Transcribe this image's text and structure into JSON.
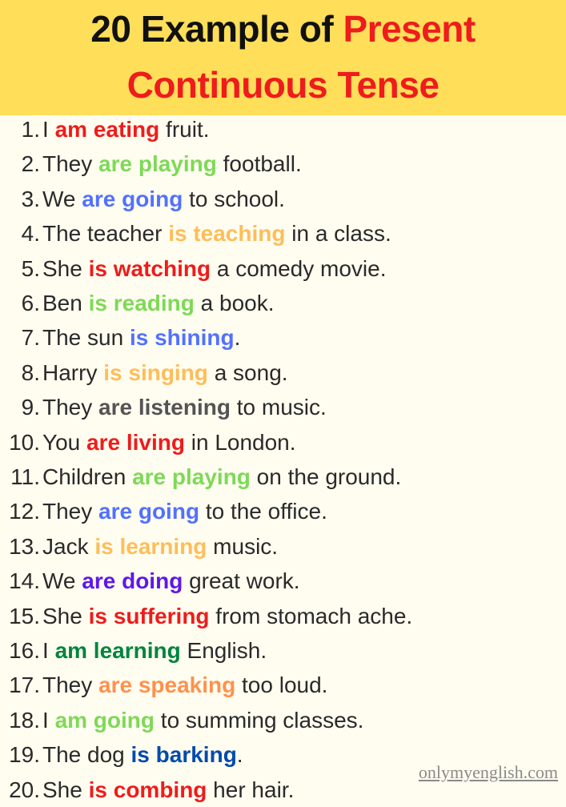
{
  "header": {
    "title_part1": "20 Example of ",
    "title_part2": "Present",
    "title_line2": "Continuous Tense",
    "background": "#ffde59",
    "accent": "#ee1c1c"
  },
  "examples": [
    {
      "num": "1.",
      "before": "I ",
      "verb": "am eating",
      "after": " fruit.",
      "color": "#ee1c1c"
    },
    {
      "num": "2.",
      "before": "They ",
      "verb": "are playing",
      "after": " football.",
      "color": "#7ed957"
    },
    {
      "num": "3.",
      "before": "We ",
      "verb": "are going",
      "after": " to school.",
      "color": "#5271ff"
    },
    {
      "num": "4.",
      "before": "The teacher ",
      "verb": "is teaching",
      "after": " in a class.",
      "color": "#ffbd59"
    },
    {
      "num": "5.",
      "before": "She ",
      "verb": "is watching",
      "after": " a comedy movie.",
      "color": "#ee1c1c"
    },
    {
      "num": "6.",
      "before": "Ben ",
      "verb": "is reading",
      "after": " a book.",
      "color": "#7ed957"
    },
    {
      "num": "7.",
      "before": "The sun ",
      "verb": "is shining",
      "after": ".",
      "color": "#5271ff"
    },
    {
      "num": "8.",
      "before": "Harry ",
      "verb": "is singing",
      "after": " a song.",
      "color": "#ffbd59"
    },
    {
      "num": "9.",
      "before": "They ",
      "verb": "are listening",
      "after": " to music.",
      "color": "#545454"
    },
    {
      "num": "10.",
      "before": "You ",
      "verb": "are living",
      "after": " in London.",
      "color": "#ee1c1c"
    },
    {
      "num": "11.",
      "before": "Children ",
      "verb": "are playing",
      "after": " on the ground.",
      "color": "#7ed957"
    },
    {
      "num": "12.",
      "before": "They ",
      "verb": "are going",
      "after": " to the office.",
      "color": "#5271ff"
    },
    {
      "num": "13.",
      "before": "Jack ",
      "verb": "is learning",
      "after": " music.",
      "color": "#ffbd59"
    },
    {
      "num": "14.",
      "before": "We ",
      "verb": "are doing",
      "after": " great work.",
      "color": "#5e17eb"
    },
    {
      "num": "15.",
      "before": "She ",
      "verb": "is suffering",
      "after": " from stomach ache.",
      "color": "#ee1c1c"
    },
    {
      "num": "16.",
      "before": "I ",
      "verb": "am learning",
      "after": " English.",
      "color": "#00843d"
    },
    {
      "num": "17.",
      "before": "They ",
      "verb": "are speaking",
      "after": " too loud.",
      "color": "#ff914d"
    },
    {
      "num": "18.",
      "before": "I ",
      "verb": "am going",
      "after": " to summing classes.",
      "color": "#7ed957"
    },
    {
      "num": "19.",
      "before": "The dog ",
      "verb": "is barking",
      "after": ".",
      "color": "#004aad"
    },
    {
      "num": "20.",
      "before": "She ",
      "verb": "is combing",
      "after": " her hair.",
      "color": "#ee1c1c"
    }
  ],
  "watermark": "onlymyenglish.com"
}
